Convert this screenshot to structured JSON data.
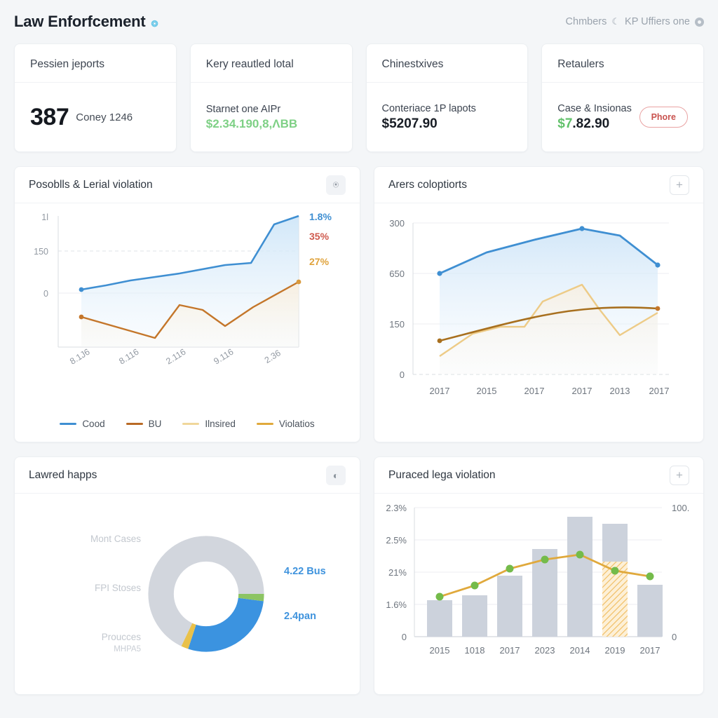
{
  "header": {
    "title": "Law Enforfcement",
    "brand_mark": "icon",
    "right_text": "Chmbers",
    "right_text2": "KP Uffiers one",
    "moon_icon": "moon-icon",
    "avatar_icon": "avatar-icon"
  },
  "kpis": [
    {
      "title": "Pessien jeports",
      "big": "387",
      "sub": "Coney 1246"
    },
    {
      "title": "Kery reautled lotal",
      "line1": "Starnet one AIPr",
      "money": "$2.34.190,8,ΛBB"
    },
    {
      "title": "Chinestxives",
      "line1": "Conteriace 1P lapots",
      "money": "$5207.90"
    },
    {
      "title": "Retaulers",
      "line1": "Case & Insionas",
      "money_green": "$7",
      "money_rest": ".82.90",
      "badge": "Phore"
    }
  ],
  "panels": {
    "area_chart": {
      "title": "Posoblls & Lerial violation",
      "action_icon": "download-icon"
    },
    "line_chart": {
      "title": "Arers coloptiorts",
      "action_icon": "plus-icon"
    },
    "donut_chart": {
      "title": "Lawred happs",
      "action_icon": "refresh-icon"
    },
    "bar_chart": {
      "title": "Puraced lega violation",
      "action_icon": "plus-icon"
    }
  },
  "chart_data": [
    {
      "id": "area_chart",
      "type": "area",
      "title": "Posoblls & Lerial violation",
      "categories": [
        "8.1J6",
        "8.116",
        "2.116",
        "9.116",
        "2.36"
      ],
      "yticks": [
        "1l",
        "150",
        "0"
      ],
      "ylim": [
        -60,
        260
      ],
      "grid": true,
      "series": [
        {
          "name": "Cood",
          "color": "#3f8fd2",
          "values": [
            10,
            38,
            62,
            100,
            135,
            232
          ]
        },
        {
          "name": "BU",
          "color": "#c4762a",
          "values": [
            -33,
            -62,
            -80,
            -30,
            -52,
            18
          ]
        }
      ],
      "end_labels": [
        {
          "text": "1.8%",
          "color": "#3f8fd2"
        },
        {
          "text": "35%",
          "color": "#cf5a4e"
        },
        {
          "text": "27%",
          "color": "#e0a33c"
        }
      ],
      "legend": [
        {
          "label": "Cood",
          "color": "#3f8fd2"
        },
        {
          "label": "BU",
          "color": "#b96a25"
        },
        {
          "label": "Ilnsired",
          "color": "#f0d79b"
        },
        {
          "label": "Violatios",
          "color": "#e0a93c"
        }
      ],
      "legend_position": "bottom"
    },
    {
      "id": "line_chart",
      "type": "line",
      "title": "Arers coloptiorts",
      "categories": [
        "2017",
        "2015",
        "2017",
        "2017",
        "2013",
        "2017"
      ],
      "yticks": [
        "300",
        "650",
        "150",
        "0"
      ],
      "ylim": [
        0,
        330
      ],
      "grid": true,
      "series": [
        {
          "name": "blue",
          "color": "#3f8fd2",
          "values": [
            170,
            232,
            262,
            285,
            310,
            238
          ]
        },
        {
          "name": "brown",
          "color": "#a8701f",
          "values": [
            72,
            118,
            140,
            165,
            182,
            180
          ]
        },
        {
          "name": "light",
          "color": "#edcb87",
          "values": [
            40,
            105,
            110,
            200,
            218,
            128
          ]
        }
      ]
    },
    {
      "id": "donut_chart",
      "type": "pie",
      "title": "Lawred happs",
      "left_labels": [
        "Mont Cases",
        "FPI Stoses",
        "Proucces"
      ],
      "left_sub": "MHPA5",
      "right_labels": [
        "4.22 Bus",
        "2.4pan"
      ],
      "slices": [
        {
          "name": "blue",
          "value": 28,
          "color": "#3b93e0"
        },
        {
          "name": "gold",
          "value": 2,
          "color": "#e9c14a"
        },
        {
          "name": "grey",
          "value": 68,
          "color": "#d2d6dd"
        },
        {
          "name": "green",
          "value": 2,
          "color": "#8cc463"
        }
      ]
    },
    {
      "id": "bar_chart",
      "type": "bar",
      "title": "Puraced lega violation",
      "categories": [
        "2015",
        "1018",
        "2017",
        "2023",
        "2014",
        "2019",
        "2017"
      ],
      "yticks_left": [
        "2.3%",
        "2.5%",
        "21%",
        "1.6%",
        "0"
      ],
      "yticks_right": [
        "100.",
        "0"
      ],
      "ylim": [
        0,
        100
      ],
      "grid": true,
      "series": [
        {
          "name": "bars",
          "type": "bar",
          "color": "#ccd2dc",
          "values": [
            28,
            32,
            47,
            69,
            93,
            86,
            43
          ]
        },
        {
          "name": "line",
          "type": "line",
          "color": "#e0a93c",
          "marker_color": "#74bb4a",
          "values": [
            30,
            38,
            53,
            60,
            64,
            52,
            48
          ]
        }
      ],
      "highlight_bar_index": 5,
      "highlight_pattern": "hatched-orange"
    }
  ]
}
